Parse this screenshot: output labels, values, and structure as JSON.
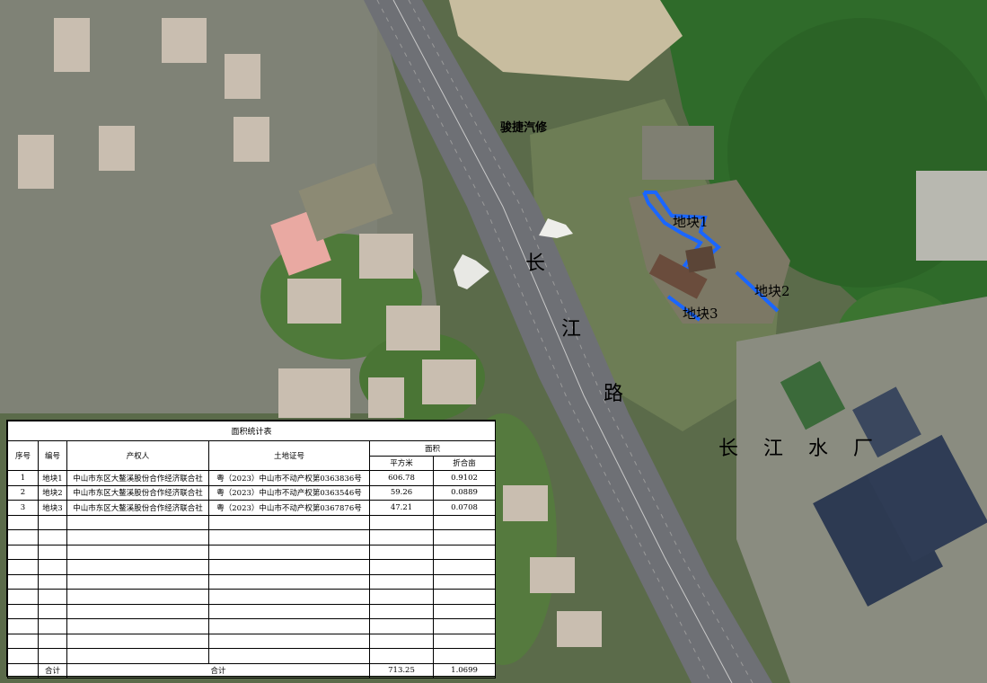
{
  "map": {
    "road_chars": [
      "长",
      "江",
      "路"
    ],
    "plant_chars": [
      "长",
      "江",
      "水",
      "厂"
    ],
    "shop_label": "骏捷汽修",
    "plot_labels": [
      "地块1",
      "地块2",
      "地块3"
    ],
    "plot_color": "#1a66ff"
  },
  "table": {
    "title": "面积统计表",
    "headers": {
      "seq": "序号",
      "code": "编号",
      "owner": "产权人",
      "cert": "土地证号",
      "area": "面积",
      "sqm": "平方米",
      "mu": "折合亩"
    },
    "rows": [
      {
        "seq": "1",
        "code": "地块1",
        "owner": "中山市东区大鳌溪股份合作经济联合社",
        "cert": "粤（2023）中山市不动产权第0363836号",
        "sqm": "606.78",
        "mu": "0.9102"
      },
      {
        "seq": "2",
        "code": "地块2",
        "owner": "中山市东区大鳌溪股份合作经济联合社",
        "cert": "粤（2023）中山市不动产权第0363546号",
        "sqm": "59.26",
        "mu": "0.0889"
      },
      {
        "seq": "3",
        "code": "地块3",
        "owner": "中山市东区大鳌溪股份合作经济联合社",
        "cert": "粤（2023）中山市不动产权第0367876号",
        "sqm": "47.21",
        "mu": "0.0708"
      }
    ],
    "total": {
      "label_left": "合计",
      "label_mid": "合计",
      "sqm": "713.25",
      "mu": "1.0699"
    }
  }
}
